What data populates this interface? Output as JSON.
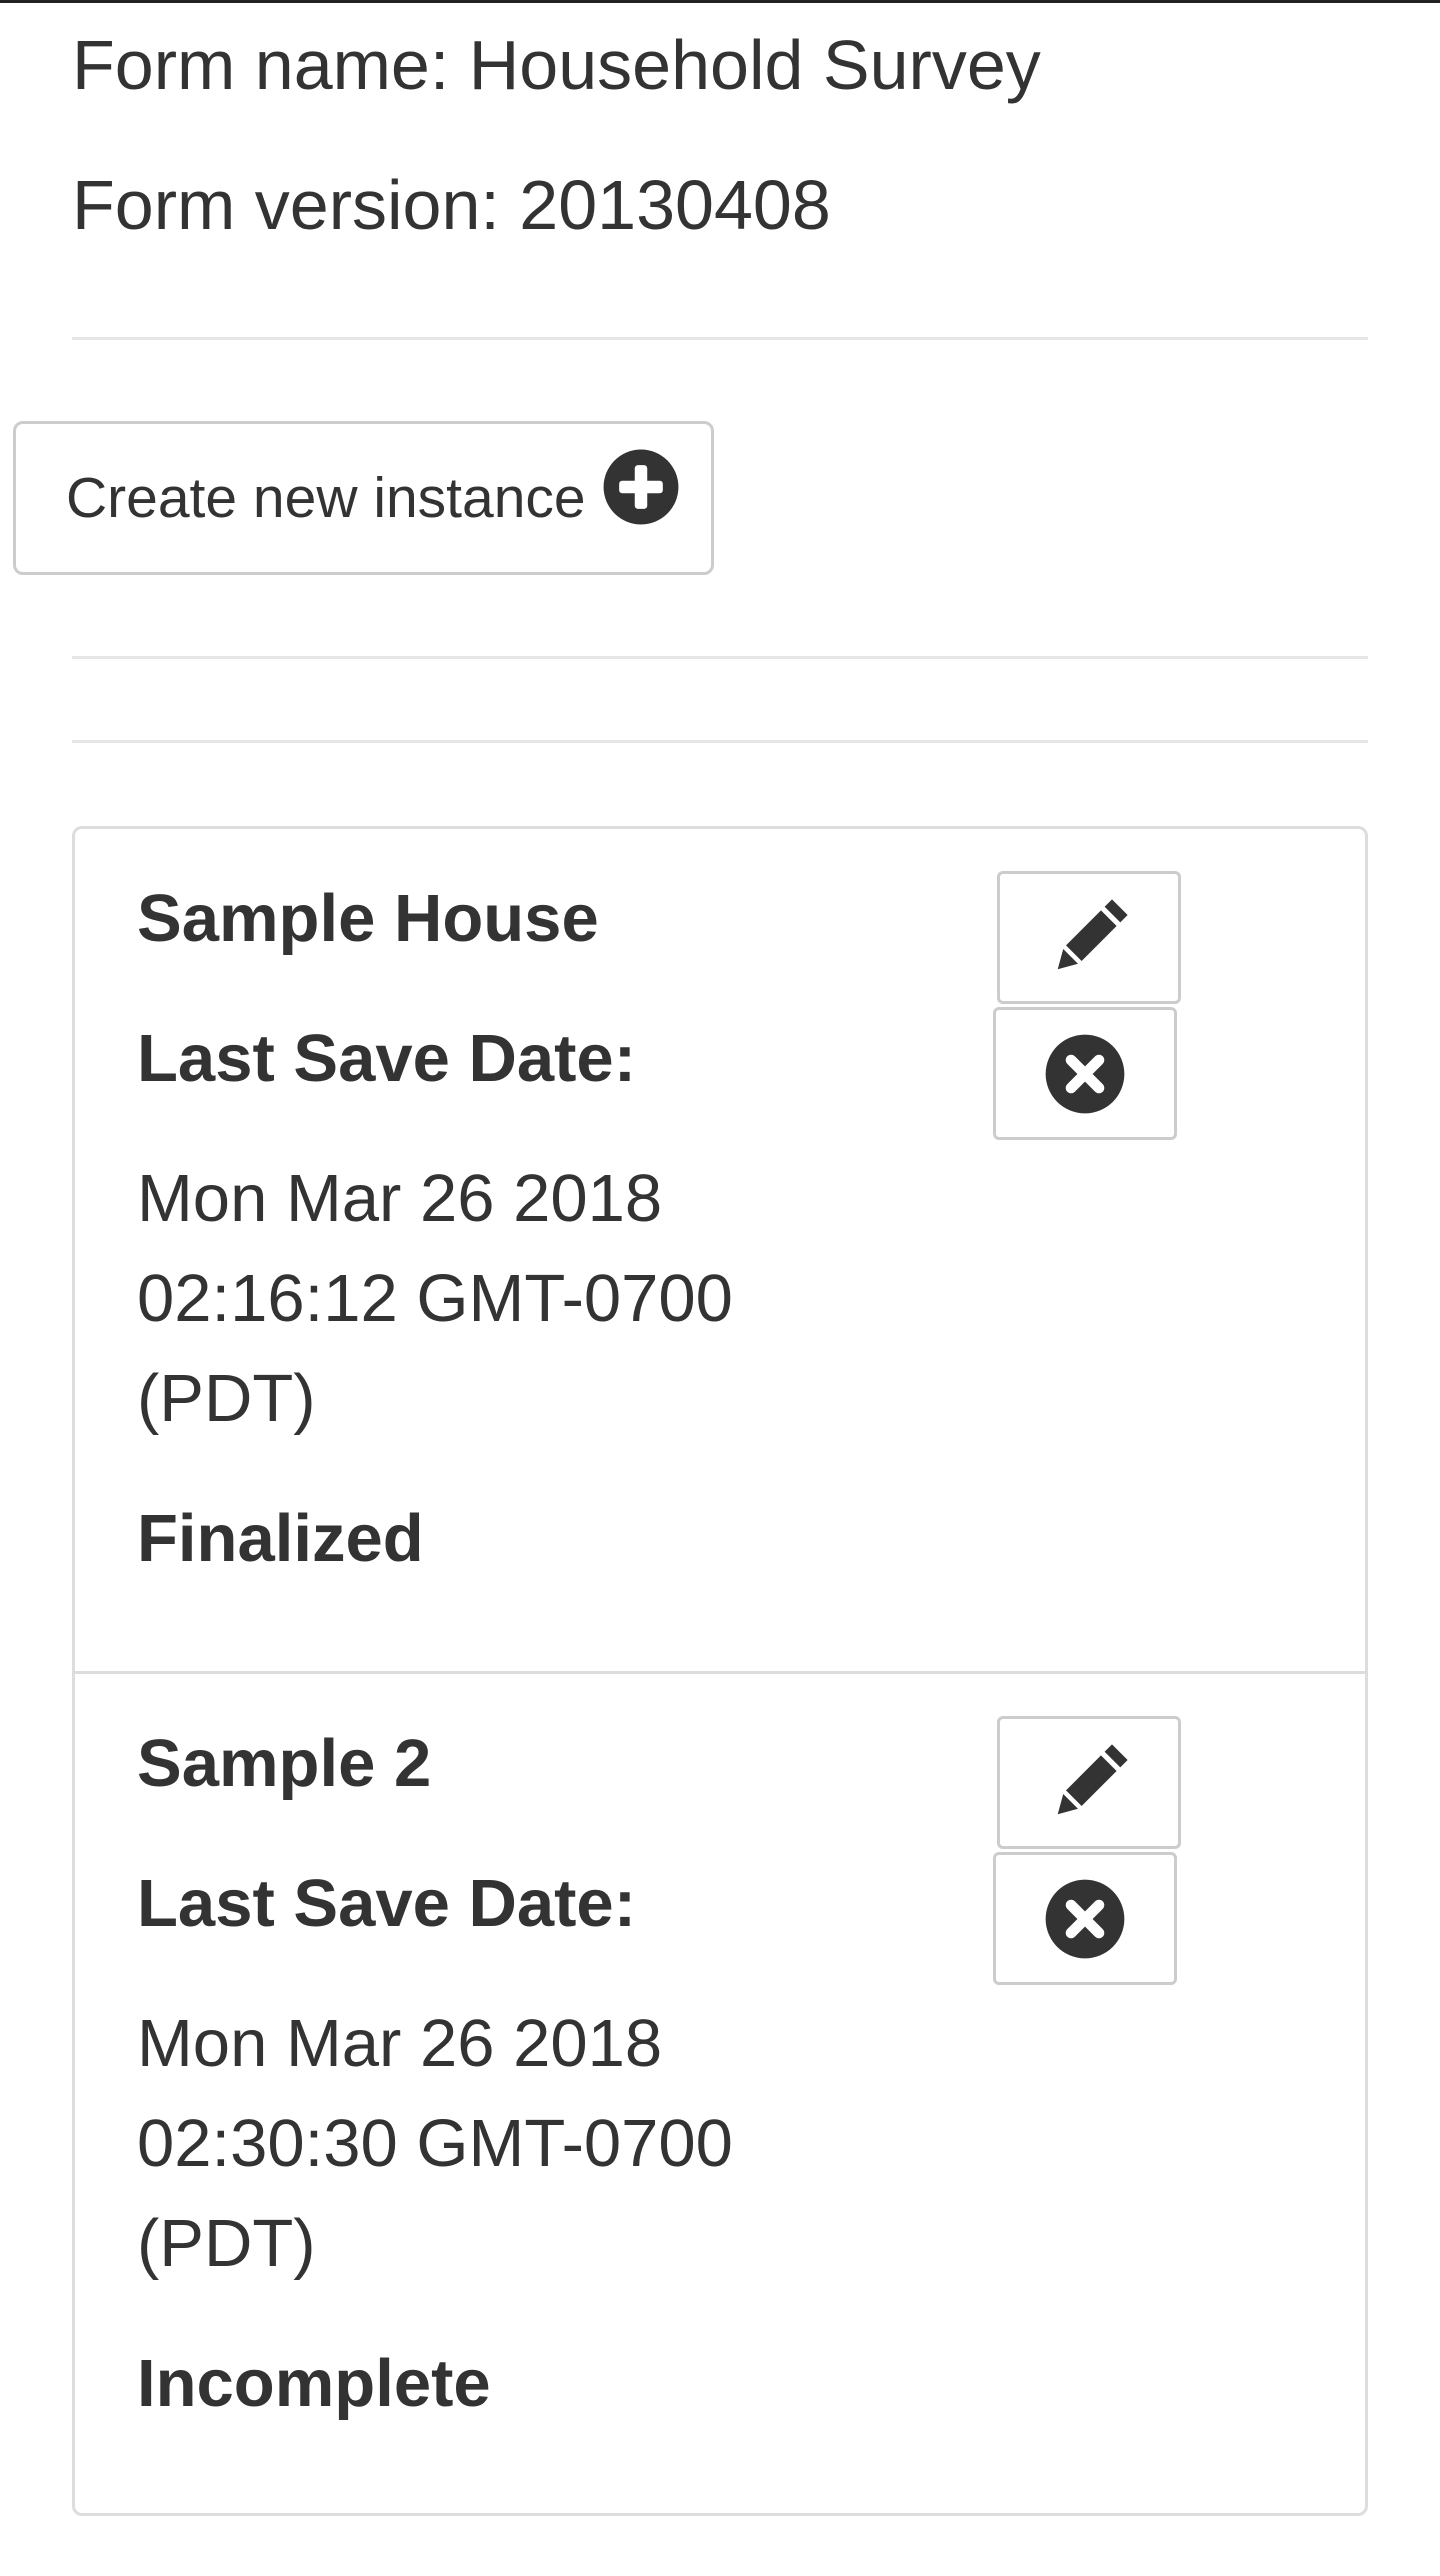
{
  "form": {
    "name_line": "Form name: Household Survey",
    "version_line": "Form version: 20130408"
  },
  "actions": {
    "create_label": "Create new instance",
    "create_icon": "plus-circle-icon"
  },
  "instances": [
    {
      "name": "Sample House",
      "save_label": "Last Save Date:",
      "date_line1": "Mon Mar 26 2018",
      "date_line2": "02:16:12 GMT-0700",
      "date_line3": "(PDT)",
      "status": "Finalized"
    },
    {
      "name": "Sample 2",
      "save_label": "Last Save Date:",
      "date_line1": "Mon Mar 26 2018",
      "date_line2": "02:30:30 GMT-0700",
      "date_line3": "(PDT)",
      "status": "Incomplete"
    }
  ],
  "icons": {
    "edit": "pencil-icon",
    "delete": "times-circle-icon"
  },
  "colors": {
    "text": "#333333",
    "border": "#cccccc",
    "divider": "#e6e6e6"
  }
}
